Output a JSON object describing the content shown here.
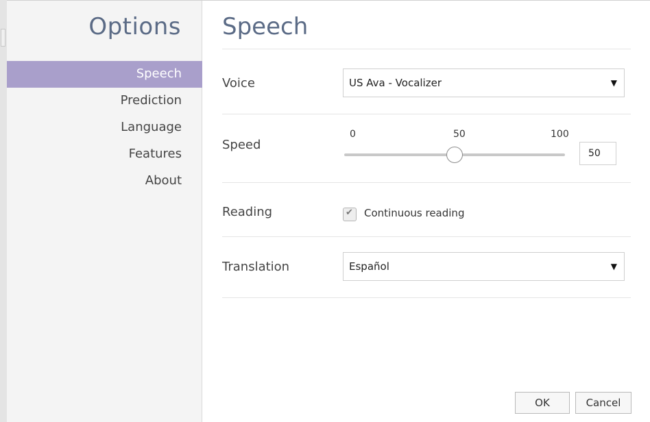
{
  "sidebar": {
    "title": "Options",
    "items": [
      {
        "label": "Speech",
        "active": true
      },
      {
        "label": "Prediction"
      },
      {
        "label": "Language"
      },
      {
        "label": "Features"
      },
      {
        "label": "About"
      }
    ]
  },
  "main": {
    "title": "Speech",
    "voice": {
      "label": "Voice",
      "value": "US Ava - Vocalizer"
    },
    "speed": {
      "label": "Speed",
      "min_label": "0",
      "mid_label": "50",
      "max_label": "100",
      "value": "50",
      "fraction": 0.5
    },
    "reading": {
      "label": "Reading",
      "checkbox_label": "Continuous reading",
      "checked": true
    },
    "translation": {
      "label": "Translation",
      "value": "Español"
    }
  },
  "buttons": {
    "ok": "OK",
    "cancel": "Cancel"
  },
  "icons": {
    "caret": "caret-down-icon",
    "check": "checkmark-icon"
  },
  "colors": {
    "accent": "#a99fcb",
    "title": "#5b6b86"
  }
}
